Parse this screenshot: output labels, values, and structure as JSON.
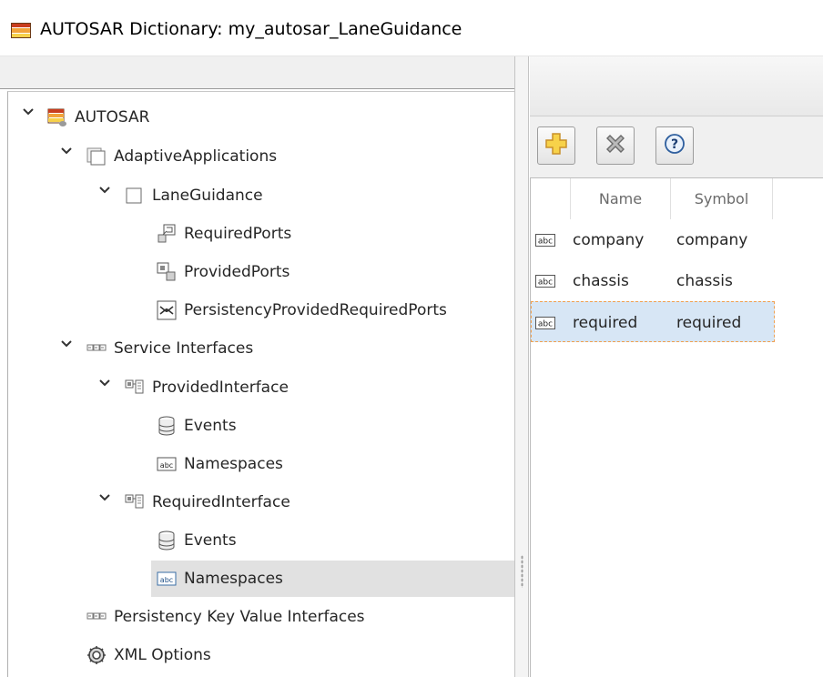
{
  "window": {
    "title": "AUTOSAR Dictionary: my_autosar_LaneGuidance",
    "icon": "autosar-dictionary-icon"
  },
  "tree": {
    "nodes": [
      {
        "label": "AUTOSAR",
        "icon": "autosar-package-icon",
        "expanded": true
      },
      {
        "label": "AdaptiveApplications",
        "icon": "adaptive-applications-icon",
        "expanded": true
      },
      {
        "label": "LaneGuidance",
        "icon": "component-icon",
        "expanded": true
      },
      {
        "label": "RequiredPorts",
        "icon": "required-port-icon"
      },
      {
        "label": "ProvidedPorts",
        "icon": "provided-port-icon"
      },
      {
        "label": "PersistencyProvidedRequiredPorts",
        "icon": "persistency-port-icon"
      },
      {
        "label": "Service Interfaces",
        "icon": "interfaces-icon",
        "expanded": true
      },
      {
        "label": "ProvidedInterface",
        "icon": "service-interface-icon",
        "expanded": true
      },
      {
        "label": "Events",
        "icon": "events-icon"
      },
      {
        "label": "Namespaces",
        "icon": "namespaces-icon"
      },
      {
        "label": "RequiredInterface",
        "icon": "service-interface-icon",
        "expanded": true
      },
      {
        "label": "Events",
        "icon": "events-icon"
      },
      {
        "label": "Namespaces",
        "icon": "namespaces-icon",
        "selected": true
      },
      {
        "label": "Persistency Key Value Interfaces",
        "icon": "interfaces-icon"
      },
      {
        "label": "XML Options",
        "icon": "gear-icon"
      }
    ]
  },
  "toolbar": {
    "add": "add-icon",
    "delete": "delete-icon",
    "help": "help-icon"
  },
  "table": {
    "columns": [
      "Name",
      "Symbol"
    ],
    "rows": [
      {
        "name": "company",
        "symbol": "company"
      },
      {
        "name": "chassis",
        "symbol": "chassis"
      },
      {
        "name": "required",
        "symbol": "required",
        "selected": true
      }
    ]
  },
  "colors": {
    "selection_row": "#d7e6f5",
    "tree_selection": "#e1e1e1",
    "accent_orange": "#f0a050"
  }
}
